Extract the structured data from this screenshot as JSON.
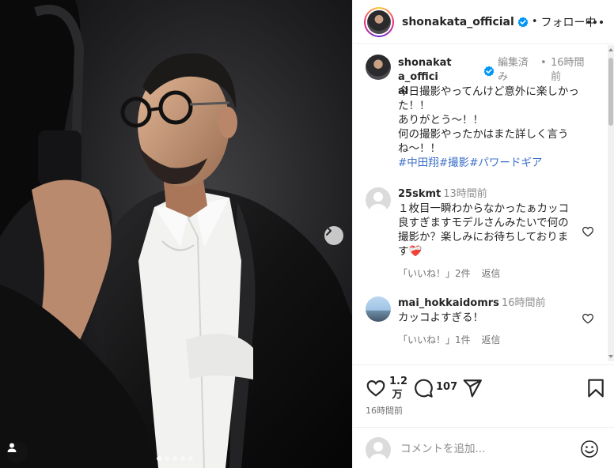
{
  "post": {
    "author": "shonakata_official",
    "follow_status": "フォロー中",
    "header_separator": "•"
  },
  "caption": {
    "author_line1": "shonakata_offici",
    "author_line2": "al",
    "edited_line1": "編集済",
    "edited_line2": "み",
    "separator": "•",
    "time_line1": "16時間",
    "time_line2": "前",
    "lines": [
      "今日撮影やってんけど意外に楽しかった！！",
      "ありがとう〜！！",
      "何の撮影やったかはまた詳しく言うね〜！！"
    ],
    "hashtags": [
      "#中田翔",
      "#撮影",
      "#パワードギア"
    ]
  },
  "comments": [
    {
      "username": "25skmt",
      "time": "13時間前",
      "text": "１枚目一瞬わからなかったぁカッコ良すぎますモデルさんみたいで何の撮影か？楽しみにお待ちしております",
      "emoji": "❤️‍🩹",
      "likes_label": "「いいね！」2件",
      "reply_label": "返信"
    },
    {
      "username": "mai_hokkaidomrs",
      "time": "16時間前",
      "text": "カッコよすぎる！",
      "likes_label": "「いいね！」1件",
      "reply_label": "返信"
    }
  ],
  "actions": {
    "like_count_line1": "1.2",
    "like_count_line2": "万",
    "comment_count": "107",
    "post_time": "16時間前"
  },
  "add_comment": {
    "placeholder": "コメントを追加..."
  },
  "carousel": {
    "total_slides": 5,
    "active_slide": 1
  },
  "colors": {
    "verified_blue": "#0095f6",
    "hashtag_blue": "#3d70c9",
    "secondary_text": "#8e8e8e"
  }
}
